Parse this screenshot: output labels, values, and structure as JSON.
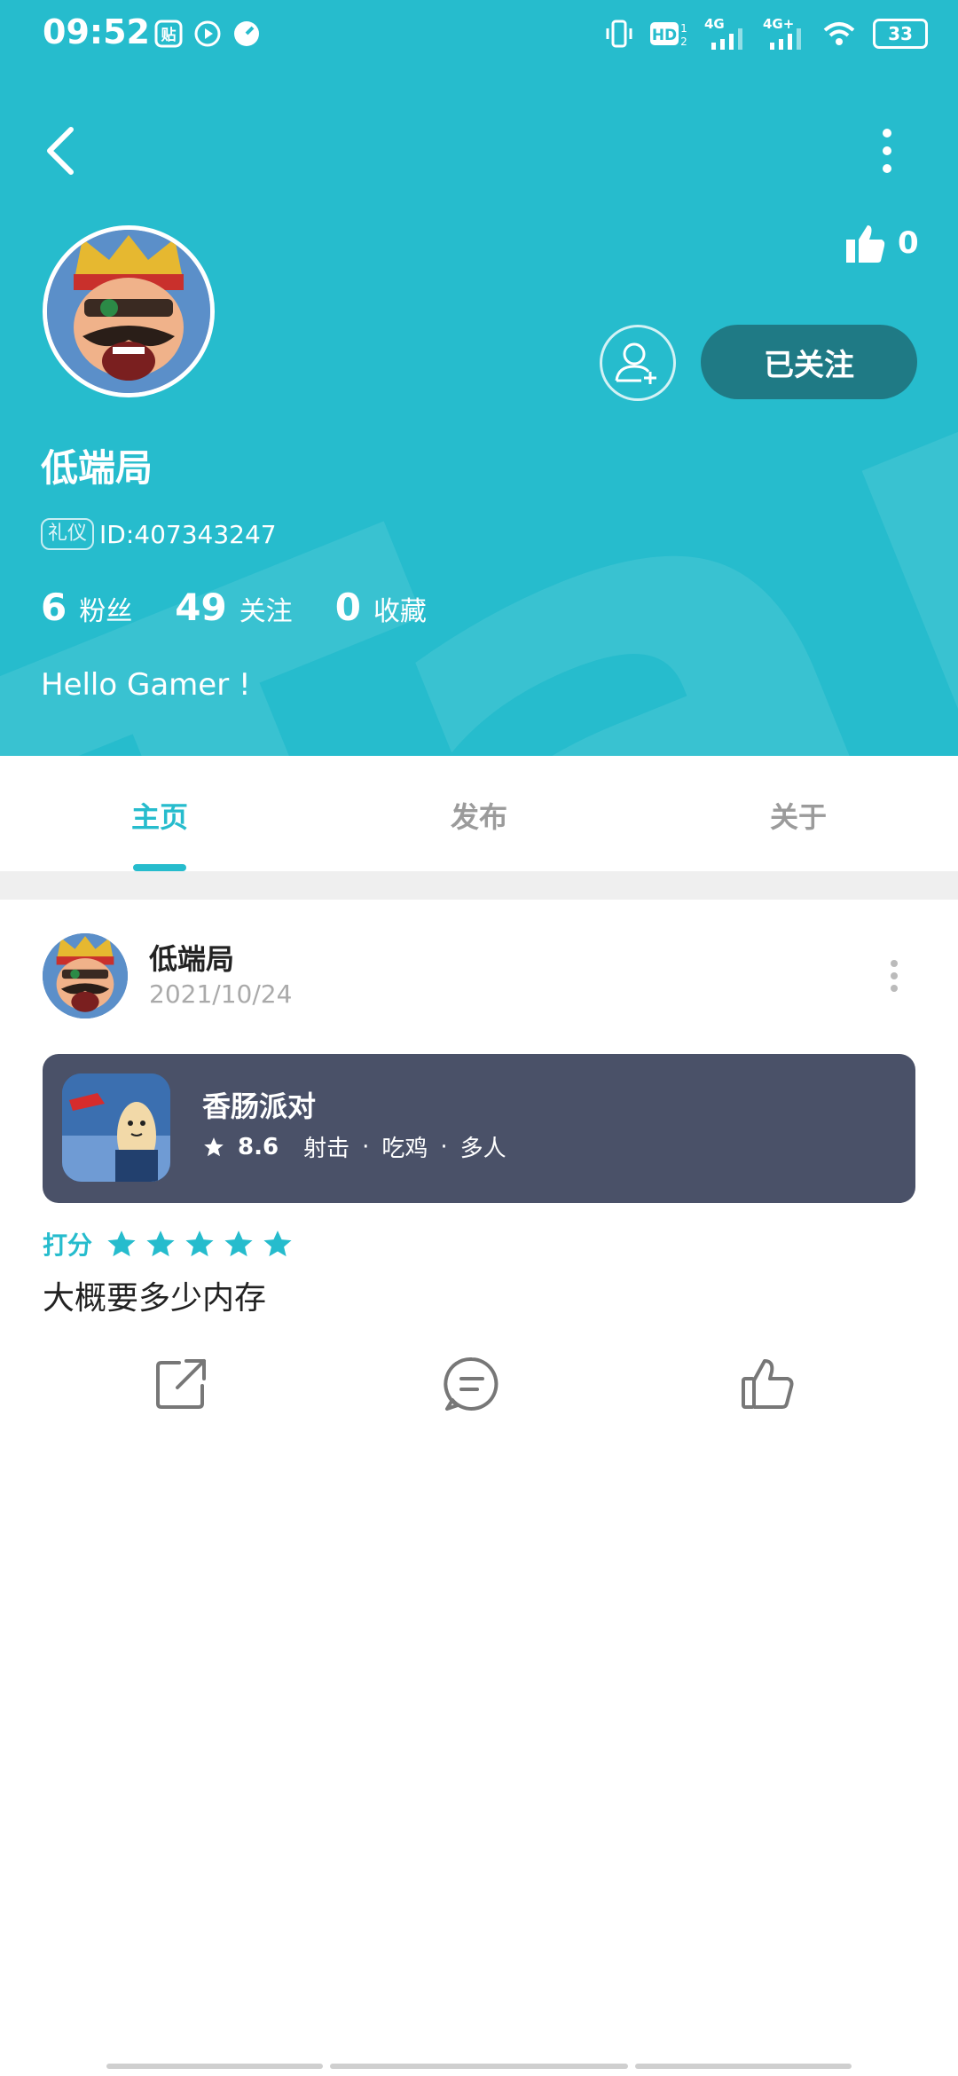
{
  "status_bar": {
    "time": "09:52",
    "app_icons": [
      "tieba-icon",
      "video-icon",
      "speed-icon"
    ],
    "network": "4G",
    "network2": "4G+",
    "battery": "33"
  },
  "header": {
    "likes": "0",
    "follow_label": "已关注",
    "username": "低端局",
    "badge": "礼仪",
    "user_id": "ID:407343247",
    "stats": [
      {
        "num": "6",
        "label": "粉丝"
      },
      {
        "num": "49",
        "label": "关注"
      },
      {
        "num": "0",
        "label": "收藏"
      }
    ],
    "bio": "Hello Gamer !",
    "accent_color": "#26bccd"
  },
  "tabs": [
    {
      "label": "主页",
      "active": true
    },
    {
      "label": "发布",
      "active": false
    },
    {
      "label": "关于",
      "active": false
    }
  ],
  "post": {
    "author": "低端局",
    "date": "2021/10/24",
    "game": {
      "name": "香肠派对",
      "score": "8.6",
      "tags": [
        "射击",
        "吃鸡",
        "多人"
      ]
    },
    "rating_label": "打分",
    "stars": 5,
    "text": "大概要多少内存"
  }
}
